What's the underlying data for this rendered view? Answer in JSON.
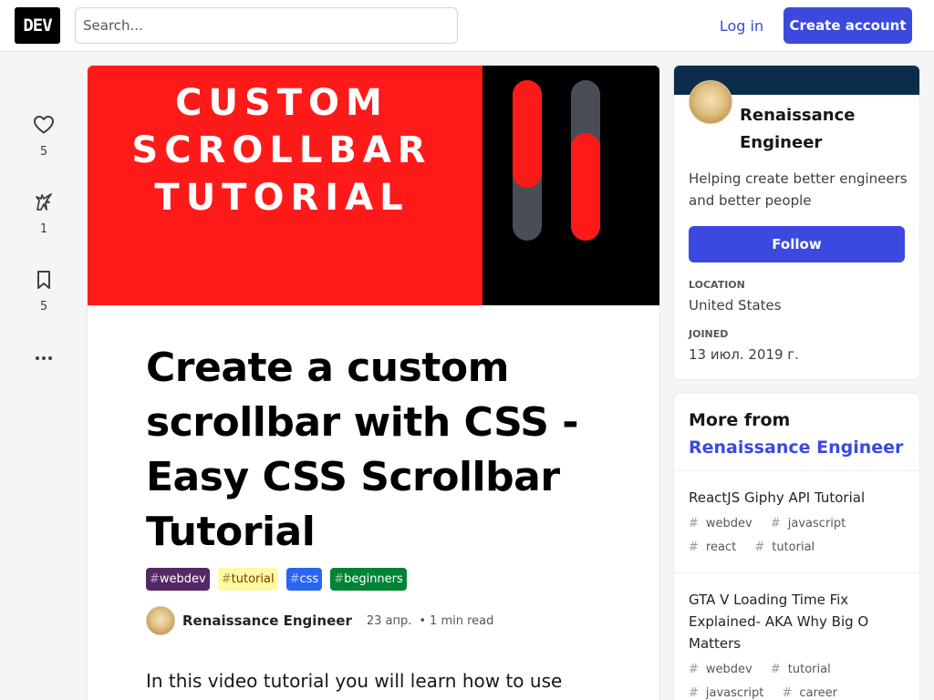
{
  "header": {
    "logo": "DEV",
    "search_placeholder": "Search...",
    "login": "Log in",
    "create_account": "Create account"
  },
  "reactions": {
    "likes": "5",
    "unicorns": "1",
    "saves": "5"
  },
  "cover": {
    "lines": [
      "CUSTOM",
      "SCROLLBAR",
      "TUTORIAL"
    ],
    "colors": {
      "red": "#ff1a1a",
      "dark_panel": "#000000",
      "track": "#4a4d55"
    }
  },
  "article": {
    "title": "Create a custom scrollbar with CSS - Easy CSS Scrollbar Tutorial",
    "tags": [
      {
        "hash": "#",
        "name": "webdev",
        "bg": "#562765",
        "fg": "#ffffff"
      },
      {
        "hash": "#",
        "name": "tutorial",
        "bg": "#fef9a2",
        "fg": "#7a3c00"
      },
      {
        "hash": "#",
        "name": "css",
        "bg": "#2965f1",
        "fg": "#ffffff"
      },
      {
        "hash": "#",
        "name": "beginners",
        "bg": "#008335",
        "fg": "#ffffff"
      }
    ],
    "author": "Renaissance Engineer",
    "date": "23 апр.",
    "separator": "•",
    "read_time": "1 min read",
    "body": "In this video tutorial you will learn how to use CSS to"
  },
  "profile": {
    "name": "Renaissance Engineer",
    "bio": "Helping create better engineers and better people",
    "follow": "Follow",
    "location_label": "LOCATION",
    "location": "United States",
    "joined_label": "JOINED",
    "joined": "13 июл. 2019 г.",
    "band_color": "#0b2d4c"
  },
  "more": {
    "prefix": "More from ",
    "author": "Renaissance Engineer",
    "posts": [
      {
        "title": "ReactJS Giphy API Tutorial",
        "tags": [
          "webdev",
          "javascript",
          "react",
          "tutorial"
        ]
      },
      {
        "title": "GTA V Loading Time Fix Explained- AKA Why Big O Matters",
        "tags": [
          "webdev",
          "tutorial",
          "javascript",
          "career"
        ]
      }
    ]
  }
}
